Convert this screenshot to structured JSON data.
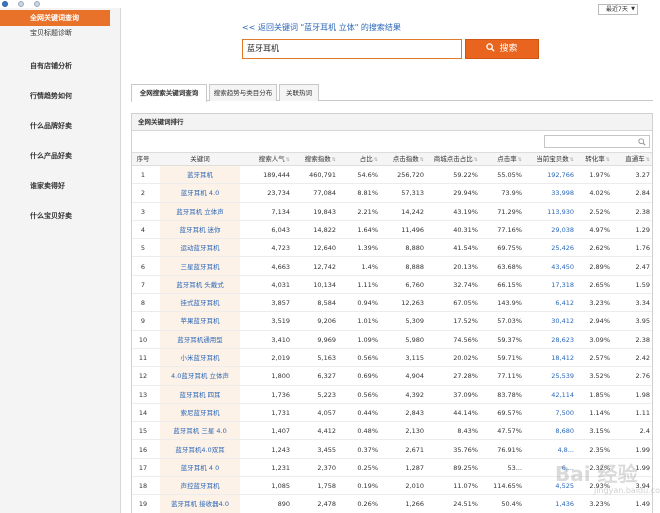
{
  "sidebar": {
    "items": [
      {
        "label": "全网关键词查询",
        "active": true
      },
      {
        "label": "宝贝标题诊断",
        "active": false
      },
      {
        "label": "自有店铺分析",
        "active": false
      },
      {
        "label": "行情趋势如何",
        "active": false
      },
      {
        "label": "什么品牌好卖",
        "active": false
      },
      {
        "label": "什么产品好卖",
        "active": false
      },
      {
        "label": "谁家卖得好",
        "active": false
      },
      {
        "label": "什么宝贝好卖",
        "active": false
      }
    ]
  },
  "header": {
    "date_range": "最近7天",
    "back_link": "<< 返回关键词 \"蓝牙耳机 立体\" 的搜索结果",
    "search_value": "蓝牙耳机",
    "search_button": "搜索"
  },
  "tabs": [
    {
      "label": "全网搜索关键词查询",
      "active": true
    },
    {
      "label": "搜索趋势与类目分布",
      "active": false
    },
    {
      "label": "关联热词",
      "active": false
    }
  ],
  "panel": {
    "title": "全网关键词排行",
    "filter_placeholder": ""
  },
  "table": {
    "headers": [
      "序号",
      "关键词",
      "搜索人气",
      "搜索指数",
      "占比",
      "点击指数",
      "商城点击占比",
      "点击率",
      "当前宝贝数",
      "转化率",
      "直通车"
    ],
    "rows": [
      [
        "1",
        "蓝牙耳机",
        "189,444",
        "460,791",
        "54.6%",
        "256,720",
        "59.22%",
        "55.05%",
        "192,766",
        "1.97%",
        "3.27"
      ],
      [
        "2",
        "蓝牙耳机 4.0",
        "23,734",
        "77,084",
        "8.81%",
        "57,313",
        "29.94%",
        "73.9%",
        "33,998",
        "4.02%",
        "2.84"
      ],
      [
        "3",
        "蓝牙耳机 立体声",
        "7,134",
        "19,843",
        "2.21%",
        "14,242",
        "43.19%",
        "71.29%",
        "113,930",
        "2.52%",
        "2.38"
      ],
      [
        "4",
        "蓝牙耳机 迷你",
        "6,043",
        "14,822",
        "1.64%",
        "11,496",
        "40.31%",
        "77.16%",
        "29,038",
        "4.97%",
        "1.29"
      ],
      [
        "5",
        "运动蓝牙耳机",
        "4,723",
        "12,640",
        "1.39%",
        "8,880",
        "41.54%",
        "69.75%",
        "25,426",
        "2.62%",
        "1.76"
      ],
      [
        "6",
        "三星蓝牙耳机",
        "4,663",
        "12,742",
        "1.4%",
        "8,888",
        "20.13%",
        "63.68%",
        "43,450",
        "2.89%",
        "2.47"
      ],
      [
        "7",
        "蓝牙耳机 头戴式",
        "4,031",
        "10,134",
        "1.11%",
        "6,760",
        "32.74%",
        "66.15%",
        "17,318",
        "2.65%",
        "1.59"
      ],
      [
        "8",
        "挂式蓝牙耳机",
        "3,857",
        "8,584",
        "0.94%",
        "12,263",
        "67.05%",
        "143.9%",
        "6,412",
        "3.23%",
        "3.34"
      ],
      [
        "9",
        "苹果蓝牙耳机",
        "3,519",
        "9,206",
        "1.01%",
        "5,309",
        "17.52%",
        "57.03%",
        "30,412",
        "2.94%",
        "3.95"
      ],
      [
        "10",
        "蓝牙耳机通用型",
        "3,410",
        "9,969",
        "1.09%",
        "5,980",
        "74.56%",
        "59.37%",
        "28,623",
        "3.09%",
        "2.38"
      ],
      [
        "11",
        "小米蓝牙耳机",
        "2,019",
        "5,163",
        "0.56%",
        "3,115",
        "20.02%",
        "59.71%",
        "18,412",
        "2.57%",
        "2.42"
      ],
      [
        "12",
        "4.0蓝牙耳机 立体声",
        "1,800",
        "6,327",
        "0.69%",
        "4,904",
        "27.28%",
        "77.11%",
        "25,539",
        "3.52%",
        "2.76"
      ],
      [
        "13",
        "蓝牙耳机 四耳",
        "1,736",
        "5,223",
        "0.56%",
        "4,392",
        "37.09%",
        "83.78%",
        "42,114",
        "1.85%",
        "1.98"
      ],
      [
        "14",
        "索尼蓝牙耳机",
        "1,731",
        "4,057",
        "0.44%",
        "2,843",
        "44.14%",
        "69.57%",
        "7,500",
        "1.14%",
        "1.11"
      ],
      [
        "15",
        "蓝牙耳机 三星 4.0",
        "1,407",
        "4,412",
        "0.48%",
        "2,130",
        "8.43%",
        "47.57%",
        "8,680",
        "3.15%",
        "2.4"
      ],
      [
        "16",
        "蓝牙耳机4.0双耳",
        "1,243",
        "3,455",
        "0.37%",
        "2,671",
        "35.76%",
        "76.91%",
        "4,8...",
        "2.35%",
        "1.99"
      ],
      [
        "17",
        "蓝牙耳机 4 0",
        "1,231",
        "2,370",
        "0.25%",
        "1,287",
        "89.25%",
        "53...",
        "6,...",
        "2.32%",
        "1.99"
      ],
      [
        "18",
        "声控蓝牙耳机",
        "1,085",
        "1,758",
        "0.19%",
        "2,010",
        "11.07%",
        "114.65%",
        "4,525",
        "2.93%",
        "3.94"
      ],
      [
        "19",
        "蓝牙耳机 接收器4.0",
        "890",
        "2,478",
        "0.26%",
        "1,266",
        "24.51%",
        "50.4%",
        "1,436",
        "3.23%",
        "1.49"
      ]
    ]
  },
  "watermark": {
    "brand": "Bai 经验",
    "sub": "jingyan.baidu.com"
  },
  "colors": {
    "accent": "#e8722a",
    "search_button": "#e8641f",
    "link": "#2b67b8",
    "keyword_column_bg": "#fdf2e7"
  }
}
